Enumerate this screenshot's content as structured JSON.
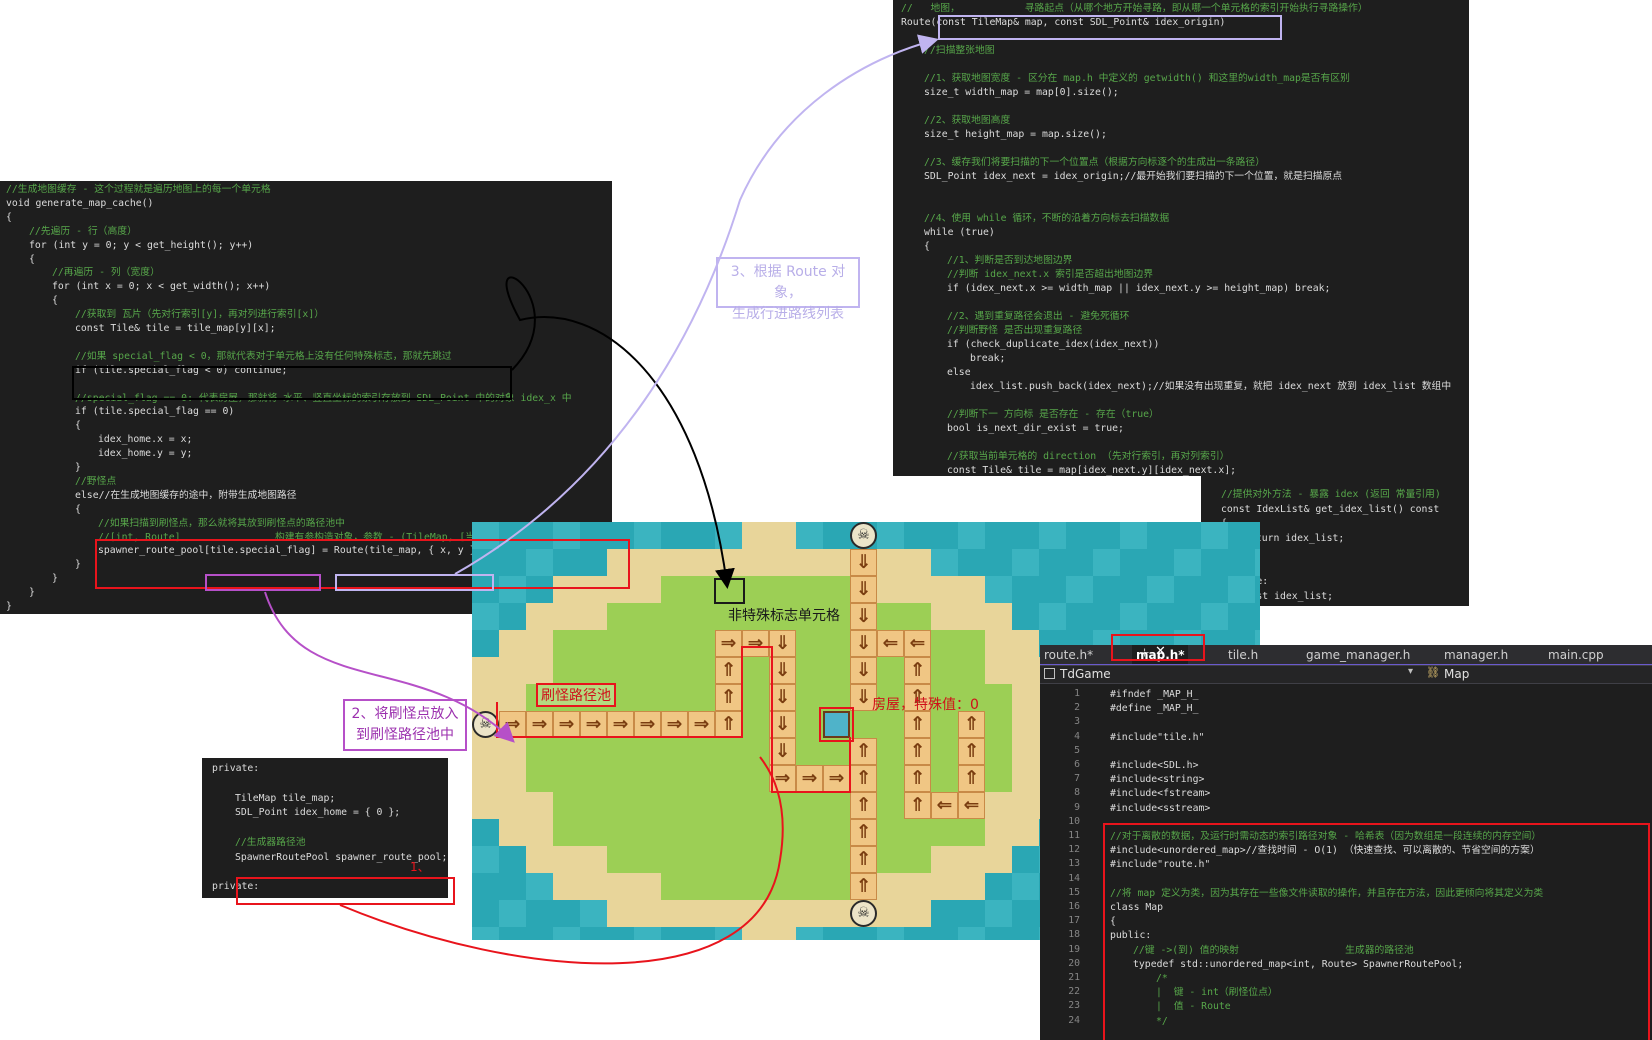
{
  "left_code": {
    "lines": [
      {
        "i": 0,
        "cls": "cm",
        "t": "//生成地图缓存 - 这个过程就是遍历地图上的每一个单元格"
      },
      {
        "i": 0,
        "t": "void generate_map_cache()"
      },
      {
        "i": 0,
        "t": "{"
      },
      {
        "i": 1,
        "cls": "cm",
        "t": "//先遍历 - 行（高度）"
      },
      {
        "i": 1,
        "t": "for (int y = 0; y < get_height(); y++)"
      },
      {
        "i": 1,
        "t": "{"
      },
      {
        "i": 2,
        "cls": "cm",
        "t": "//再遍历 - 列（宽度）"
      },
      {
        "i": 2,
        "t": "for (int x = 0; x < get_width(); x++)"
      },
      {
        "i": 2,
        "t": "{"
      },
      {
        "i": 3,
        "cls": "cm",
        "t": "//获取到 瓦片（先对行索引[y]，再对列进行索引[x]）"
      },
      {
        "i": 3,
        "t": "const Tile& tile = tile_map[y][x];"
      },
      {
        "i": 3,
        "t": ""
      },
      {
        "i": 3,
        "cls": "cm",
        "t": "//如果 special_flag < 0，那就代表对于单元格上没有任何特殊标志，那就先跳过"
      },
      {
        "i": 3,
        "t": "if (tile.special_flag < 0) continue;"
      },
      {
        "i": 3,
        "t": ""
      },
      {
        "i": 3,
        "cls": "cm",
        "t": "//special_flag == 0: 代表房屋，那就将 水平、竖直坐标的索引存放到 SDL_Point 中的对象 idex_x 中"
      },
      {
        "i": 3,
        "t": "if (tile.special_flag == 0)"
      },
      {
        "i": 3,
        "t": "{"
      },
      {
        "i": 4,
        "t": "idex_home.x = x;"
      },
      {
        "i": 4,
        "t": "idex_home.y = y;"
      },
      {
        "i": 3,
        "t": "}"
      },
      {
        "i": 3,
        "cls": "cm",
        "t": "//野怪点"
      },
      {
        "i": 3,
        "t": "else//在生成地图缓存的途中，附带生成地图路径"
      },
      {
        "i": 3,
        "t": "{"
      },
      {
        "i": 4,
        "cls": "cm",
        "t": "//如果扫描到刷怪点，那么就将其放到刷怪点的路径池中"
      },
      {
        "i": 4,
        "cls": "cm",
        "t": "//[int, Route]                构建有参构造对象，参数 - (TileMap, [当前索引坐标])"
      },
      {
        "i": 4,
        "t": "spawner_route_pool[tile.special_flag] = Route(tile_map, { x, y });"
      },
      {
        "i": 3,
        "t": "}"
      },
      {
        "i": 2,
        "t": "}"
      },
      {
        "i": 1,
        "t": "}"
      },
      {
        "i": 0,
        "t": "}"
      }
    ]
  },
  "right_code": {
    "lines": [
      {
        "i": 0,
        "cls": "cm",
        "t": "//   地图，           寻路起点（从哪个地方开始寻路，即从哪一个单元格的索引开始执行寻路操作）"
      },
      {
        "i": 0,
        "t": "Route(const TileMap& map, const SDL_Point& idex_origin)"
      },
      {
        "i": 0,
        "t": ""
      },
      {
        "i": 1,
        "cls": "cm",
        "t": "//扫描整张地图"
      },
      {
        "i": 1,
        "t": ""
      },
      {
        "i": 1,
        "cls": "cm",
        "t": "//1、获取地图宽度 - 区分在 map.h 中定义的 getwidth() 和这里的width_map是否有区别"
      },
      {
        "i": 1,
        "t": "size_t width_map = map[0].size();"
      },
      {
        "i": 1,
        "t": ""
      },
      {
        "i": 1,
        "cls": "cm",
        "t": "//2、获取地图高度"
      },
      {
        "i": 1,
        "t": "size_t height_map = map.size();"
      },
      {
        "i": 1,
        "t": ""
      },
      {
        "i": 1,
        "cls": "cm",
        "t": "//3、缓存我们将要扫描的下一个位置点（根据方向标逐个的生成出一条路径）"
      },
      {
        "i": 1,
        "t": "SDL_Point idex_next = idex_origin;//最开始我们要扫描的下一个位置，就是扫描原点"
      },
      {
        "i": 1,
        "t": ""
      },
      {
        "i": 1,
        "t": ""
      },
      {
        "i": 1,
        "cls": "cm",
        "t": "//4、使用 while 循环，不断的沿着方向标去扫描数据"
      },
      {
        "i": 1,
        "t": "while (true)"
      },
      {
        "i": 1,
        "t": "{"
      },
      {
        "i": 2,
        "cls": "cm",
        "t": "//1、判断是否到达地图边界"
      },
      {
        "i": 2,
        "cls": "cm",
        "t": "//判断 idex_next.x 索引是否超出地图边界"
      },
      {
        "i": 2,
        "t": "if (idex_next.x >= width_map || idex_next.y >= height_map) break;"
      },
      {
        "i": 2,
        "t": ""
      },
      {
        "i": 2,
        "cls": "cm",
        "t": "//2、遇到重复路径会退出 - 避免死循环"
      },
      {
        "i": 2,
        "cls": "cm",
        "t": "//判断野怪 是否出现重复路径"
      },
      {
        "i": 2,
        "t": "if (check_duplicate_idex(idex_next))"
      },
      {
        "i": 3,
        "t": "break;"
      },
      {
        "i": 2,
        "t": "else"
      },
      {
        "i": 3,
        "t": "idex_list.push_back(idex_next);//如果没有出现重复，就把 idex_next 放到 idex_list 数组中"
      },
      {
        "i": 2,
        "t": ""
      },
      {
        "i": 2,
        "cls": "cm",
        "t": "//判断下一 方向标 是否存在 - 存在（true）"
      },
      {
        "i": 2,
        "t": "bool is_next_dir_exist = true;"
      },
      {
        "i": 2,
        "t": ""
      },
      {
        "i": 2,
        "cls": "cm",
        "t": "//获取当前单元格的 direction （先对行索引，再对列索引）"
      },
      {
        "i": 2,
        "t": "const Tile& tile = map[idex_next.y][idex_next.x];"
      }
    ]
  },
  "getter_code": {
    "lines": [
      {
        "i": 0,
        "cls": "cm",
        "t": "//提供对外方法 - 暴露 idex (返回 常量引用)"
      },
      {
        "i": 0,
        "t": "const IdexList& get_idex_list() const"
      },
      {
        "i": 0,
        "t": "{"
      },
      {
        "i": 1,
        "t": "return idex_list;"
      },
      {
        "i": 0,
        "t": "}"
      },
      {
        "i": 0,
        "t": ""
      },
      {
        "i": -1,
        "t": "private:"
      },
      {
        "i": 0,
        "t": "IdexList idex_list;"
      },
      {
        "i": 0,
        "cls": "cm",
        "t": "/*"
      }
    ]
  },
  "private_code": {
    "lines": [
      {
        "i": 0,
        "t": "private:"
      },
      {
        "i": 0,
        "t": ""
      },
      {
        "i": 1,
        "t": "TileMap tile_map;"
      },
      {
        "i": 1,
        "t": "SDL_Point idex_home = { 0 };"
      },
      {
        "i": 1,
        "t": ""
      },
      {
        "i": 1,
        "cls": "cm",
        "t": "//生成器路径池"
      },
      {
        "i": 1,
        "t": "SpawnerRoutePool spawner_route_pool;"
      },
      {
        "i": 0,
        "t": ""
      },
      {
        "i": 0,
        "t": "private:"
      }
    ],
    "marker": "1、"
  },
  "editor": {
    "tabs": [
      "route.h*",
      "map.h*",
      "tile.h",
      "game_manager.h",
      "manager.h",
      "main.cpp"
    ],
    "active_tab": "map.h*",
    "project": "TdGame",
    "scope": "Map",
    "line_numbers": [
      1,
      2,
      3,
      4,
      5,
      6,
      7,
      8,
      9,
      10,
      11,
      12,
      13,
      14,
      15,
      16,
      17,
      18,
      19,
      20,
      21,
      22,
      23,
      24
    ],
    "lines": [
      {
        "i": 0,
        "t": "#ifndef _MAP_H_"
      },
      {
        "i": 0,
        "t": "#define _MAP_H_"
      },
      {
        "i": 0,
        "t": ""
      },
      {
        "i": 0,
        "t": "#include\"tile.h\""
      },
      {
        "i": 0,
        "t": ""
      },
      {
        "i": 0,
        "t": "#include<SDL.h>"
      },
      {
        "i": 0,
        "t": "#include<string>"
      },
      {
        "i": 0,
        "t": "#include<fstream>"
      },
      {
        "i": 0,
        "t": "#include<sstream>"
      },
      {
        "i": 0,
        "t": ""
      },
      {
        "i": 0,
        "cls": "cm",
        "t": "//对于离散的数据，及运行时需动态的索引路径对象 - 哈希表（因为数组是一段连续的内存空间）"
      },
      {
        "i": 0,
        "t": "#include<unordered_map>//查找时间 - O(1) （快速查找、可以离散的、节省空间的方案）"
      },
      {
        "i": 0,
        "t": "#include\"route.h\""
      },
      {
        "i": 0,
        "t": ""
      },
      {
        "i": 0,
        "cls": "cm",
        "t": "//将 map 定义为类，因为其存在一些像文件读取的操作，并且存在方法，因此更倾向将其定义为类"
      },
      {
        "i": 0,
        "t": "class Map"
      },
      {
        "i": 0,
        "t": "{"
      },
      {
        "i": 0,
        "t": "public:"
      },
      {
        "i": 1,
        "cls": "cm",
        "t": "//键 ->(到) 值的映射                  生成器的路径池"
      },
      {
        "i": 1,
        "t": "typedef std::unordered_map<int, Route> SpawnerRoutePool;"
      },
      {
        "i": 2,
        "cls": "cm",
        "t": "/*"
      },
      {
        "i": 2,
        "cls": "cm",
        "t": "|  键 - int（刷怪位点）"
      },
      {
        "i": 2,
        "cls": "cm",
        "t": "|  值 - Route"
      },
      {
        "i": 2,
        "cls": "cm",
        "t": "*/"
      }
    ]
  },
  "annotations": {
    "step1": "1、",
    "step2_line1": "2、将刷怪点放入",
    "step2_line2": "到刷怪路径池中",
    "step3_line1": "3、根据 Route 对象，",
    "step3_line2": "生成行进路线列表"
  },
  "map": {
    "label_non_special": "非特殊标志单元格",
    "label_pool": "刷怪路径池",
    "label_house": "房屋，特殊值：0"
  },
  "colors": {
    "code_bg": "#1e1e1e",
    "comment": "#57a64a",
    "keyword": "#569cd6",
    "box_red": "#e8141c",
    "box_purple": "#b650c8",
    "box_lavender": "#c0b4f0",
    "box_black": "#000000",
    "water": "#2aa7b4",
    "grass": "#9ccf55",
    "sand": "#e8d59a"
  }
}
